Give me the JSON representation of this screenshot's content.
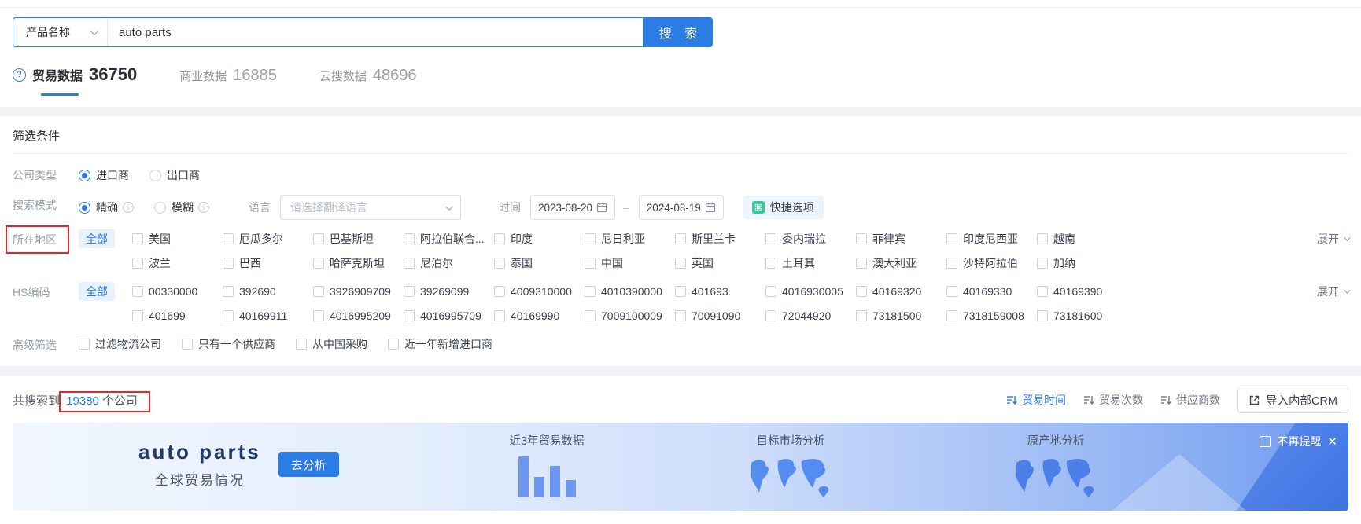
{
  "search": {
    "category_label": "产品名称",
    "query": "auto parts",
    "button_label": "搜 索"
  },
  "tabs": [
    {
      "label": "贸易数据",
      "count": "36750"
    },
    {
      "label": "商业数据",
      "count": "16885"
    },
    {
      "label": "云搜数据",
      "count": "48696"
    }
  ],
  "filters": {
    "title": "筛选条件",
    "company_type": {
      "label": "公司类型",
      "options": [
        {
          "label": "进口商",
          "selected": true
        },
        {
          "label": "出口商",
          "selected": false
        }
      ]
    },
    "search_mode": {
      "label": "搜索模式",
      "options": [
        {
          "label": "精确",
          "selected": true
        },
        {
          "label": "模糊",
          "selected": false
        }
      ]
    },
    "language": {
      "label": "语言",
      "placeholder": "请选择翻译语言"
    },
    "time": {
      "label": "时间",
      "start": "2023-08-20",
      "separator": "–",
      "end": "2024-08-19"
    },
    "quick_option_label": "快捷选项",
    "region": {
      "label": "所在地区",
      "all_label": "全部",
      "expand_label": "展开",
      "rows": [
        [
          "美国",
          "厄瓜多尔",
          "巴基斯坦",
          "阿拉伯联合...",
          "印度",
          "尼日利亚",
          "斯里兰卡",
          "委内瑞拉",
          "菲律宾",
          "印度尼西亚",
          "越南"
        ],
        [
          "波兰",
          "巴西",
          "哈萨克斯坦",
          "尼泊尔",
          "泰国",
          "中国",
          "英国",
          "土耳其",
          "澳大利亚",
          "沙特阿拉伯",
          "加纳"
        ]
      ]
    },
    "hs_code": {
      "label": "HS编码",
      "all_label": "全部",
      "expand_label": "展开",
      "rows": [
        [
          "00330000",
          "392690",
          "3926909709",
          "39269099",
          "4009310000",
          "4010390000",
          "401693",
          "4016930005",
          "40169320",
          "40169330",
          "40169390"
        ],
        [
          "401699",
          "40169911",
          "4016995209",
          "4016995709",
          "40169990",
          "7009100009",
          "70091090",
          "72044920",
          "73181500",
          "7318159008",
          "73181600"
        ]
      ]
    },
    "advanced": {
      "label": "高级筛选",
      "options": [
        "过滤物流公司",
        "只有一个供应商",
        "从中国采购",
        "近一年新增进口商"
      ]
    }
  },
  "results": {
    "prefix": "共搜索到",
    "count": "19380",
    "suffix": "个公司",
    "sorts": [
      {
        "label": "贸易时间",
        "active": true
      },
      {
        "label": "贸易次数",
        "active": false
      },
      {
        "label": "供应商数",
        "active": false
      }
    ],
    "crm_button": "导入内部CRM"
  },
  "banner": {
    "title": "auto parts",
    "subtitle": "全球贸易情况",
    "analyze_button": "去分析",
    "features": [
      "近3年贸易数据",
      "目标市场分析",
      "原产地分析"
    ],
    "dismiss_label": "不再提醒",
    "close_label": "✕"
  },
  "colors": {
    "primary_blue": "#2b7ce5",
    "annotation_red": "#e02a2a",
    "quick_icon_green": "#3bc49a",
    "tag_bg": "#e8f1fe",
    "banner_deep_blue": "#6f9bf0"
  }
}
